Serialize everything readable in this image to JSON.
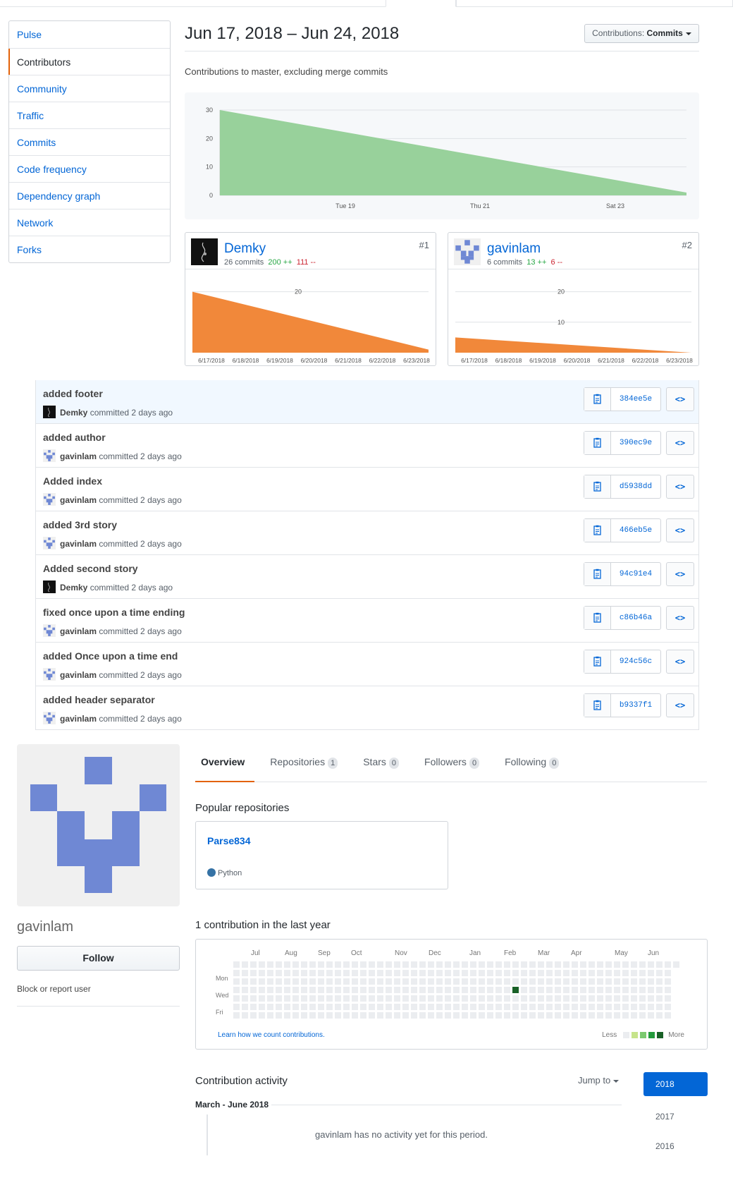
{
  "insights_menu": [
    "Pulse",
    "Contributors",
    "Community",
    "Traffic",
    "Commits",
    "Code frequency",
    "Dependency graph",
    "Network",
    "Forks"
  ],
  "selected_menu": "Contributors",
  "date_range": "Jun 17, 2018 – Jun 24, 2018",
  "contributions_button": {
    "prefix": "Contributions:",
    "value": "Commits"
  },
  "subtitle": "Contributions to master, excluding merge commits",
  "chart_data": [
    {
      "type": "area",
      "x": [
        "2018-06-17",
        "2018-06-24"
      ],
      "values": [
        30,
        1
      ],
      "xticks": [
        "Tue 19",
        "Thu 21",
        "Sat 23"
      ],
      "yticks": [
        0,
        10,
        20,
        30
      ],
      "ylim": [
        0,
        30
      ],
      "color": "#98d19b"
    },
    {
      "type": "area",
      "x": [
        "6/17/2018",
        "6/23/2018"
      ],
      "values": [
        20,
        1
      ],
      "xticks": [
        "6/17/2018",
        "6/18/2018",
        "6/19/2018",
        "6/20/2018",
        "6/21/2018",
        "6/22/2018",
        "6/23/2018"
      ],
      "yticks": [
        20
      ],
      "ylim": [
        0,
        25
      ],
      "color": "#f1883a"
    },
    {
      "type": "area",
      "x": [
        "6/17/2018",
        "6/23/2018"
      ],
      "values": [
        5,
        0
      ],
      "xticks": [
        "6/17/2018",
        "6/18/2018",
        "6/19/2018",
        "6/20/2018",
        "6/21/2018",
        "6/22/2018",
        "6/23/2018"
      ],
      "yticks": [
        10,
        20
      ],
      "ylim": [
        0,
        25
      ],
      "color": "#f1883a"
    }
  ],
  "contributors": [
    {
      "name": "Demky",
      "commits": "26 commits",
      "additions": "200 ++",
      "deletions": "111 --",
      "rank": "#1",
      "avatar": "dark"
    },
    {
      "name": "gavinlam",
      "commits": "6 commits",
      "additions": "13 ++",
      "deletions": "6 --",
      "rank": "#2",
      "avatar": "identicon"
    }
  ],
  "commits": [
    {
      "title": "added footer",
      "author": "Demky",
      "when": "committed 2 days ago",
      "sha": "384ee5e",
      "avatar": "dark"
    },
    {
      "title": "added author",
      "author": "gavinlam",
      "when": "committed 2 days ago",
      "sha": "390ec9e",
      "avatar": "identicon"
    },
    {
      "title": "Added index",
      "author": "gavinlam",
      "when": "committed 2 days ago",
      "sha": "d5938dd",
      "avatar": "identicon"
    },
    {
      "title": "added 3rd story",
      "author": "gavinlam",
      "when": "committed 2 days ago",
      "sha": "466eb5e",
      "avatar": "identicon"
    },
    {
      "title": "Added second story",
      "author": "Demky",
      "when": "committed 2 days ago",
      "sha": "94c91e4",
      "avatar": "dark"
    },
    {
      "title": "fixed once upon a time ending",
      "author": "gavinlam",
      "when": "committed 2 days ago",
      "sha": "c86b46a",
      "avatar": "identicon"
    },
    {
      "title": "added Once upon a time end",
      "author": "gavinlam",
      "when": "committed 2 days ago",
      "sha": "924c56c",
      "avatar": "identicon"
    },
    {
      "title": "added header separator",
      "author": "gavinlam",
      "when": "committed 2 days ago",
      "sha": "b9337f1",
      "avatar": "identicon"
    }
  ],
  "browse_glyph": "<>",
  "profile": {
    "username": "gavinlam",
    "follow_label": "Follow",
    "block_label": "Block or report user"
  },
  "profile_tabs": [
    {
      "label": "Overview",
      "count": null
    },
    {
      "label": "Repositories",
      "count": "1"
    },
    {
      "label": "Stars",
      "count": "0"
    },
    {
      "label": "Followers",
      "count": "0"
    },
    {
      "label": "Following",
      "count": "0"
    }
  ],
  "popular_repos_title": "Popular repositories",
  "repo": {
    "name": "Parse834",
    "language": "Python",
    "lang_color": "#3572A5"
  },
  "contrib_title": "1 contribution in the last year",
  "months": [
    "Jul",
    "Aug",
    "Sep",
    "Oct",
    "Nov",
    "Dec",
    "Jan",
    "Feb",
    "Mar",
    "Apr",
    "May",
    "Jun"
  ],
  "weekdays": [
    "Mon",
    "Wed",
    "Fri"
  ],
  "calendar": {
    "weeks": 53,
    "active_week": 33,
    "active_day": 3,
    "active_count": 1
  },
  "learn_link": "Learn how we count contributions.",
  "legend": {
    "less": "Less",
    "more": "More",
    "colors": [
      "#ebedf0",
      "#c6e48b",
      "#7bc96f",
      "#239a3b",
      "#196127"
    ]
  },
  "activity_title": "Contribution activity",
  "jump_to": "Jump to",
  "years": [
    "2018",
    "2017",
    "2016"
  ],
  "period": "March - June 2018",
  "no_activity": "gavinlam has no activity yet for this period."
}
